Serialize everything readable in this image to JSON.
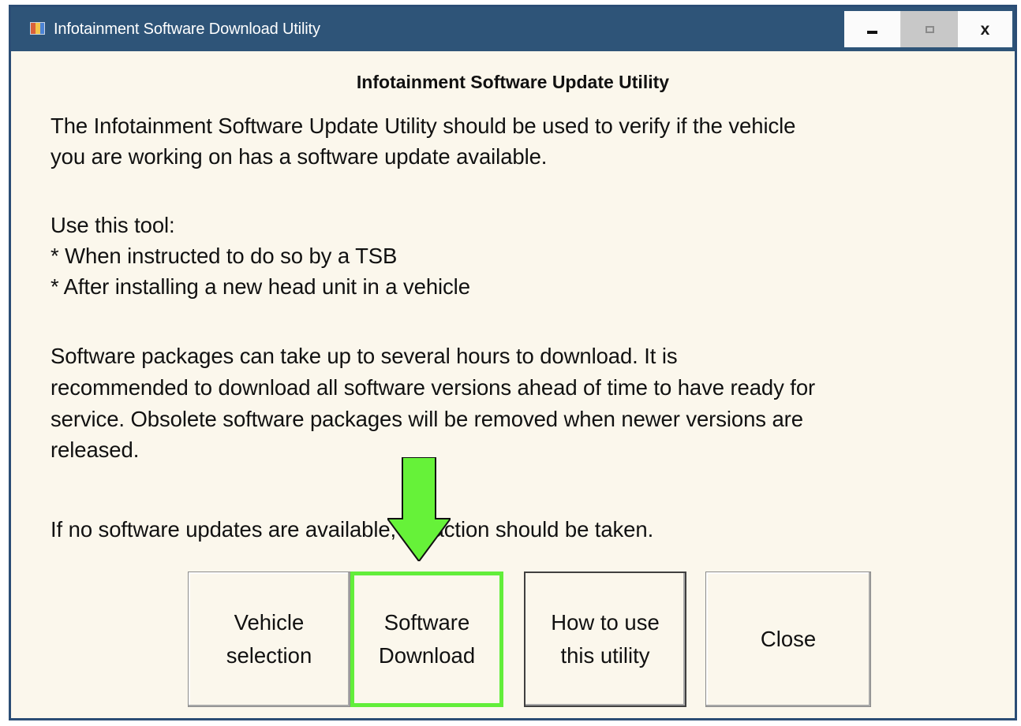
{
  "window": {
    "title": "Infotainment Software Download Utility",
    "controls": {
      "minimize": "minimize",
      "maximize": "maximize",
      "close": "close"
    }
  },
  "content": {
    "heading": "Infotainment Software Update Utility",
    "intro_lines": [
      "The Infotainment Software Update Utility should be used to verify if the vehicle",
      "you are working on has a software update available."
    ],
    "use_lines": [
      "Use this tool:",
      "* When instructed to do so by a TSB",
      "* After installing a new head unit in a vehicle"
    ],
    "download_lines": [
      "Software packages can take up to several hours to download.  It is",
      "recommended to download all software versions ahead of time to have ready for",
      "service.  Obsolete software packages will be removed when newer versions are",
      "released."
    ],
    "no_update_line": "If no software updates are available, no action should be taken."
  },
  "buttons": {
    "vehicle_selection": "Vehicle\nselection",
    "software_download": "Software\nDownload",
    "how_to_use": "How to use\nthis utility",
    "close": "Close"
  },
  "colors": {
    "titlebar": "#2e5478",
    "window_border": "#2b4d75",
    "body_background": "#fbf7ec",
    "highlight": "#62ee3a"
  },
  "icons": {
    "app": "app-icon",
    "minimize": "minimize-icon",
    "maximize": "maximize-icon",
    "close": "close-icon",
    "callout": "down-arrow-icon"
  }
}
